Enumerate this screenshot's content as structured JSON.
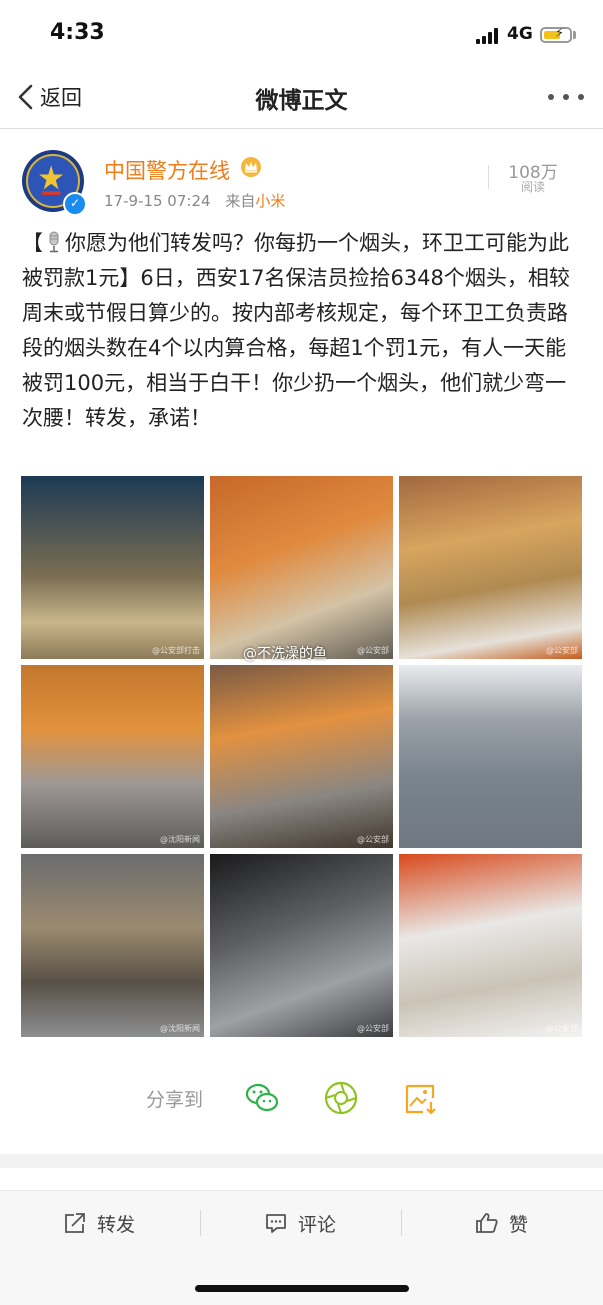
{
  "status_bar": {
    "time": "4:33",
    "network": "4G"
  },
  "nav": {
    "back_label": "返回",
    "title": "微博正文"
  },
  "post": {
    "author": "中国警方在线",
    "date": "17-9-15 07:24",
    "source_prefix": "来自",
    "source": "小米",
    "views_count": "108万",
    "views_label": "阅读",
    "text_part1": "【",
    "text_part2": "你愿为他们转发吗？你每扔一个烟头，环卫工可能为此被罚款1元】6日，西安17名保洁员捡拾6348个烟头，相较周末或节假日算少的。按内部考核规定，每个环卫工负责路段的烟头数在4个以内算合格，每超1个罚1元，有人一天能被罚100元，相当于白干！你少扔一个烟头，他们就少弯一次腰！转发，承诺！",
    "image_overlay_watermark": "@不洗澡的鱼",
    "image_watermarks": [
      "@公安部打击",
      "@公安部",
      "@公安部",
      "@沈阳新闻",
      "@公安部",
      "",
      "@沈阳新闻",
      "@公安部",
      "@公安部"
    ]
  },
  "share": {
    "label": "分享到",
    "icons": [
      "wechat-icon",
      "moments-icon",
      "save-image-icon"
    ]
  },
  "bottom_bar": {
    "repost": "转发",
    "comment": "评论",
    "like": "赞"
  },
  "colors": {
    "accent": "#f07c1a",
    "wechat": "#2cb34a",
    "moments": "#8fc31f",
    "save": "#f5a623"
  }
}
